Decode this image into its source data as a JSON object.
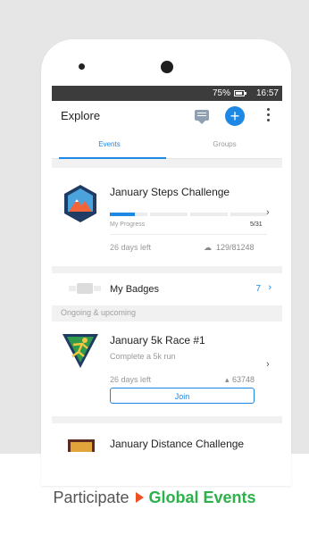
{
  "status_bar": {
    "battery": "75%",
    "time": "16:57"
  },
  "app_bar": {
    "title": "Explore"
  },
  "tabs": [
    {
      "label": "Events"
    },
    {
      "label": "Groups"
    }
  ],
  "steps_challenge": {
    "title": "January Steps Challenge",
    "progress_label": "My Progress",
    "progress_value": "5/31",
    "progress_fraction": 0.16,
    "days_left": "26 days left",
    "participants": "129/81248"
  },
  "badges": {
    "label": "My Badges",
    "count": "7"
  },
  "section_header": "Ongoing & upcoming",
  "race": {
    "title": "January 5k Race #1",
    "subtitle": "Complete a 5k run",
    "days_left": "26 days left",
    "participants": "63748",
    "join_label": "Join"
  },
  "distance_challenge": {
    "title": "January Distance Challenge"
  },
  "caption": {
    "prefix": "Participate",
    "highlight": "Global Events"
  },
  "colors": {
    "accent": "#1e88e5",
    "highlight": "#2db14a",
    "arrow": "#f04e23"
  }
}
